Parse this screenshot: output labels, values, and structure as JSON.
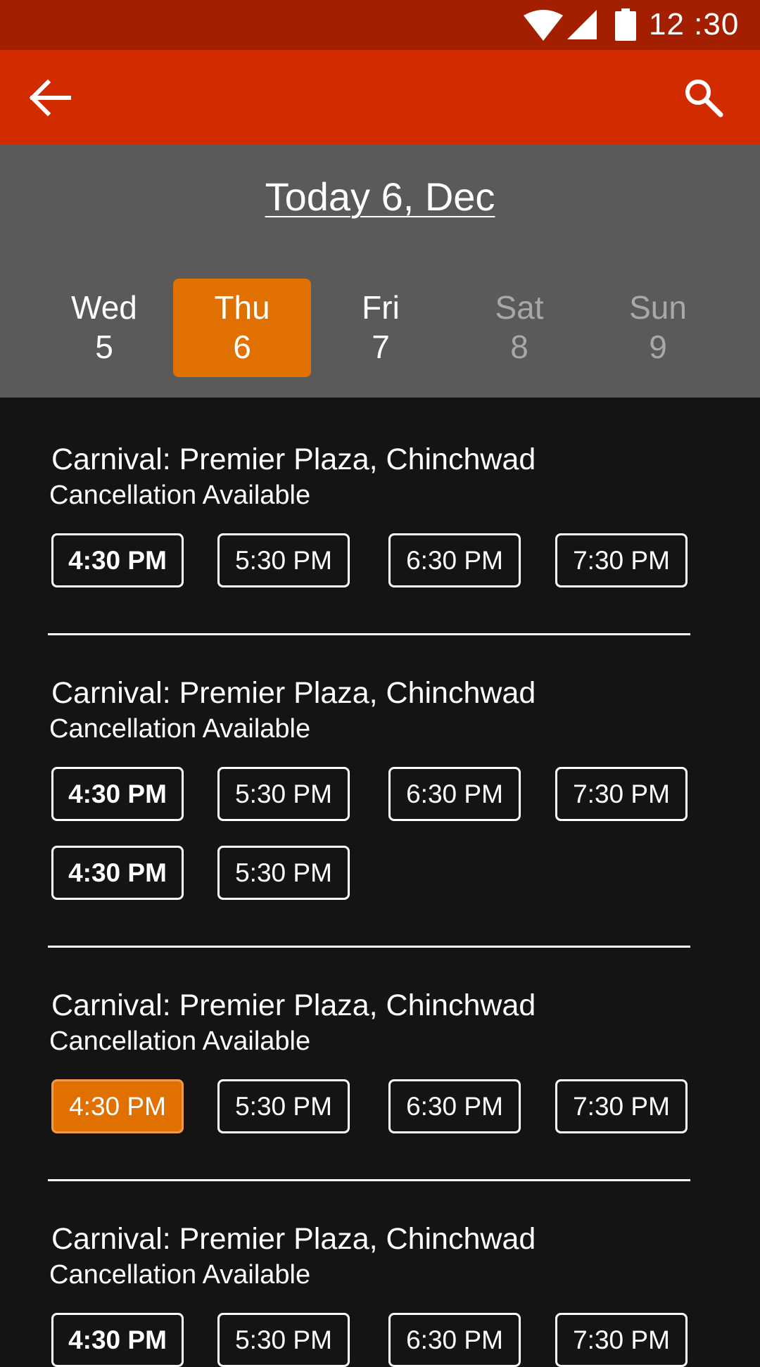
{
  "status_bar": {
    "time": "12 :30",
    "icons": [
      "wifi-icon",
      "cellular-signal-icon",
      "battery-icon"
    ]
  },
  "app_bar": {
    "back_icon": "arrow-left-icon",
    "search_icon": "search-icon"
  },
  "date_header": {
    "title": "Today 6, Dec",
    "days": [
      {
        "name": "Wed",
        "num": "5",
        "state": "normal"
      },
      {
        "name": "Thu",
        "num": "6",
        "state": "selected"
      },
      {
        "name": "Fri",
        "num": "7",
        "state": "normal"
      },
      {
        "name": "Sat",
        "num": "8",
        "state": "disabled"
      },
      {
        "name": "Sun",
        "num": "9",
        "state": "disabled"
      }
    ]
  },
  "shows": [
    {
      "title": "Carnival: Premier Plaza, Chinchwad",
      "subtitle": "Cancellation Available",
      "times": [
        {
          "label": "4:30 PM",
          "state": "available"
        },
        {
          "label": "5:30 PM",
          "state": "normal"
        },
        {
          "label": "6:30 PM",
          "state": "normal"
        },
        {
          "label": "7:30 PM",
          "state": "normal"
        }
      ]
    },
    {
      "title": "Carnival: Premier Plaza, Chinchwad",
      "subtitle": "Cancellation Available",
      "times": [
        {
          "label": "4:30 PM",
          "state": "available"
        },
        {
          "label": "5:30 PM",
          "state": "normal"
        },
        {
          "label": "6:30 PM",
          "state": "normal"
        },
        {
          "label": "7:30 PM",
          "state": "normal"
        },
        {
          "label": "4:30 PM",
          "state": "available"
        },
        {
          "label": "5:30 PM",
          "state": "normal"
        }
      ]
    },
    {
      "title": "Carnival: Premier Plaza, Chinchwad",
      "subtitle": "Cancellation Available",
      "times": [
        {
          "label": "4:30 PM",
          "state": "selected"
        },
        {
          "label": "5:30 PM",
          "state": "normal"
        },
        {
          "label": "6:30 PM",
          "state": "normal"
        },
        {
          "label": "7:30 PM",
          "state": "normal"
        }
      ]
    },
    {
      "title": "Carnival: Premier Plaza, Chinchwad",
      "subtitle": "Cancellation Available",
      "times": [
        {
          "label": "4:30 PM",
          "state": "available"
        },
        {
          "label": "5:30 PM",
          "state": "normal"
        },
        {
          "label": "6:30 PM",
          "state": "normal"
        },
        {
          "label": "7:30 PM",
          "state": "normal"
        }
      ]
    }
  ],
  "colors": {
    "status_bar": "#a31f00",
    "app_bar": "#d22b00",
    "date_panel": "#5a5a5a",
    "background": "#141414",
    "accent": "#e07000"
  }
}
